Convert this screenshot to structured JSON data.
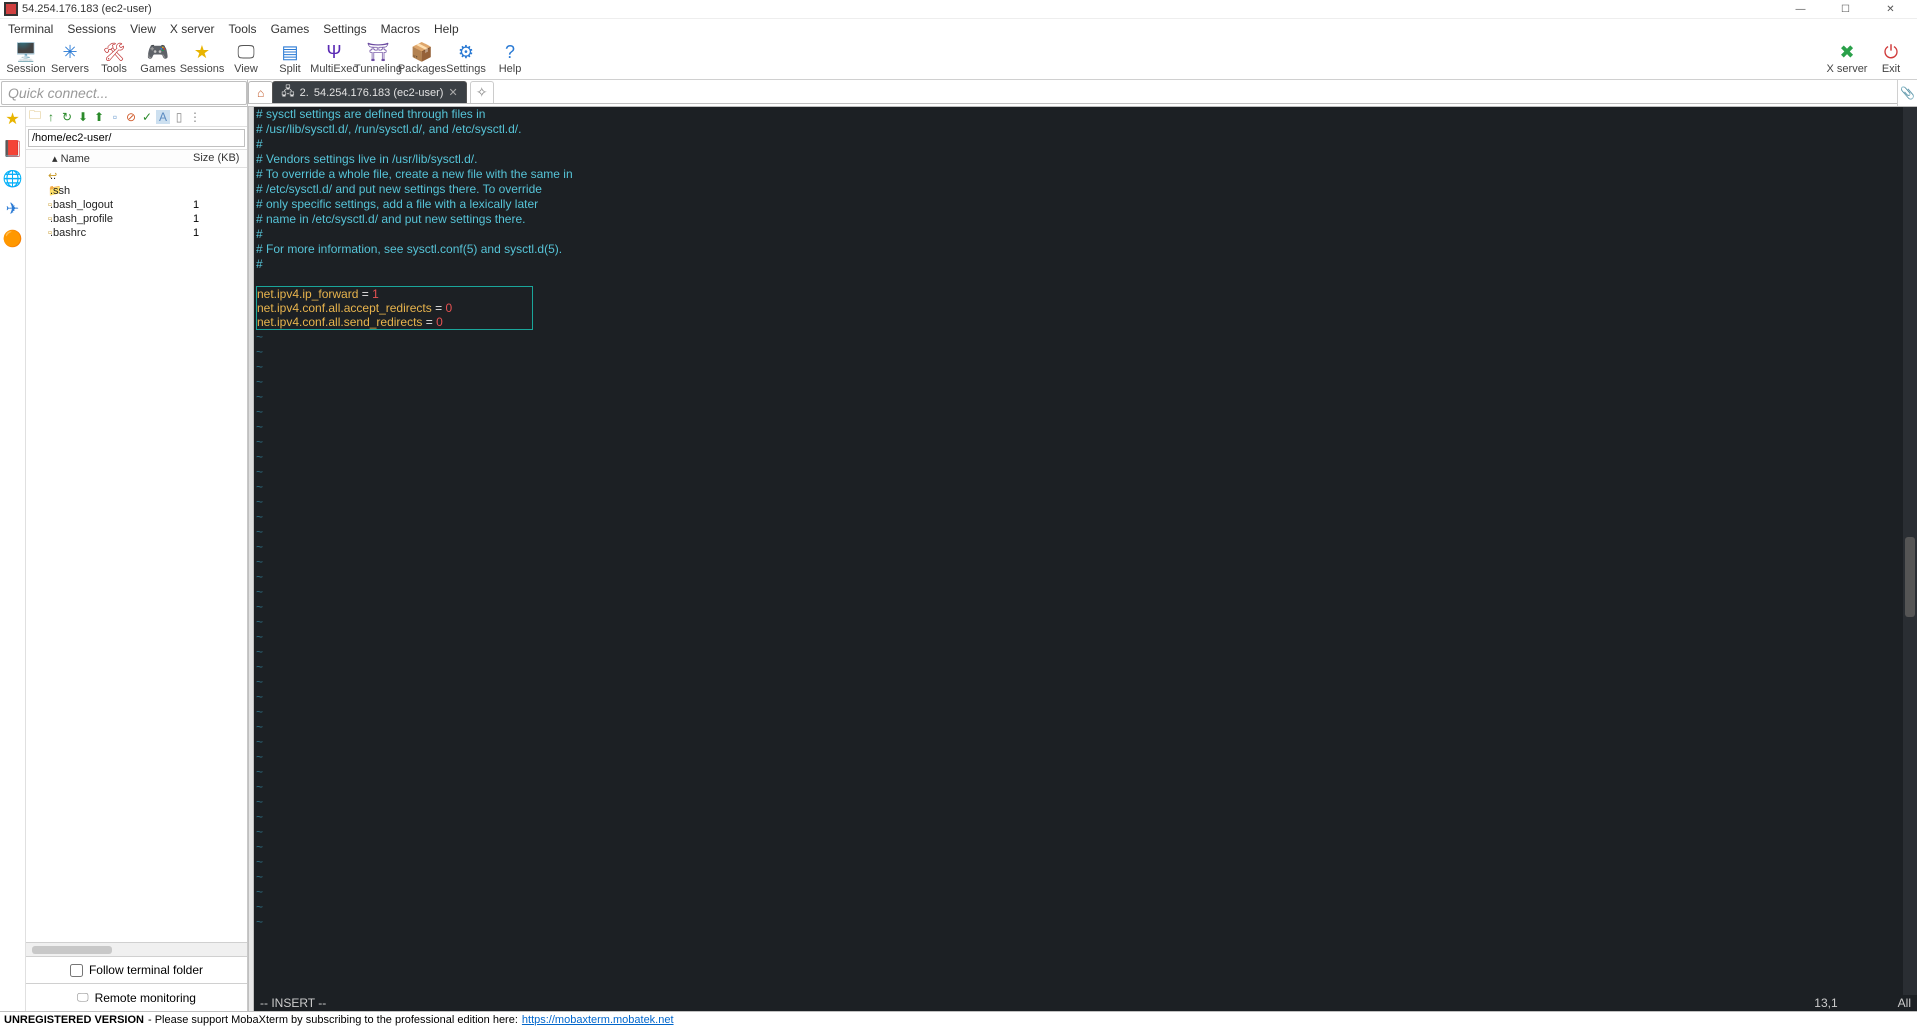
{
  "window": {
    "title": "54.254.176.183 (ec2-user)"
  },
  "menubar": [
    "Terminal",
    "Sessions",
    "View",
    "X server",
    "Tools",
    "Games",
    "Settings",
    "Macros",
    "Help"
  ],
  "toolbar": {
    "items": [
      {
        "label": "Session",
        "icon": "🖥️",
        "color": "#2a7ad4"
      },
      {
        "label": "Servers",
        "icon": "✳",
        "color": "#2a7ad4"
      },
      {
        "label": "Tools",
        "icon": "🛠",
        "color": "#c23a3a"
      },
      {
        "label": "Games",
        "icon": "🎮",
        "color": "#8a6a2a"
      },
      {
        "label": "Sessions",
        "icon": "★",
        "color": "#e8b400"
      },
      {
        "label": "View",
        "icon": "🖵",
        "color": "#555"
      },
      {
        "label": "Split",
        "icon": "▤",
        "color": "#2a7ad4"
      },
      {
        "label": "MultiExec",
        "icon": "Ψ",
        "color": "#5a2ab4"
      },
      {
        "label": "Tunneling",
        "icon": "⛩",
        "color": "#6a4aa0"
      },
      {
        "label": "Packages",
        "icon": "📦",
        "color": "#8a6a2a"
      },
      {
        "label": "Settings",
        "icon": "⚙",
        "color": "#2a7ad4"
      },
      {
        "label": "Help",
        "icon": "?",
        "color": "#2a7ad4"
      }
    ],
    "right": [
      {
        "label": "X server",
        "icon": "✖",
        "color": "#2aa04a"
      },
      {
        "label": "Exit",
        "icon": "⏻",
        "color": "#d03a3a"
      }
    ]
  },
  "quickconnect": {
    "placeholder": "Quick connect..."
  },
  "sidebar": {
    "path": "/home/ec2-user/",
    "columns": {
      "name": "Name",
      "size": "Size (KB)"
    },
    "files": [
      {
        "icon": "↩",
        "name": "..",
        "size": ""
      },
      {
        "icon": "📁",
        "name": ".ssh",
        "size": ""
      },
      {
        "icon": "▫",
        "name": ".bash_logout",
        "size": "1"
      },
      {
        "icon": "▫",
        "name": ".bash_profile",
        "size": "1"
      },
      {
        "icon": "▫",
        "name": ".bashrc",
        "size": "1"
      }
    ],
    "follow": "Follow terminal folder",
    "remote": "Remote monitoring"
  },
  "leftstrip": [
    "★",
    "📕",
    "🌐",
    "✈",
    "🟠"
  ],
  "tabs": {
    "home": {
      "icon": "⌂"
    },
    "active": {
      "num": "2.",
      "label": "54.254.176.183 (ec2-user)",
      "icon": "🖧"
    }
  },
  "terminal": {
    "comments": [
      "# sysctl settings are defined through files in",
      "# /usr/lib/sysctl.d/, /run/sysctl.d/, and /etc/sysctl.d/.",
      "#",
      "# Vendors settings live in /usr/lib/sysctl.d/.",
      "# To override a whole file, create a new file with the same in",
      "# /etc/sysctl.d/ and put new settings there. To override",
      "# only specific settings, add a file with a lexically later",
      "# name in /etc/sysctl.d/ and put new settings there.",
      "#",
      "# For more information, see sysctl.conf(5) and sysctl.d(5).",
      "#"
    ],
    "settings": [
      {
        "key": "net.ipv4.ip_forward",
        "val": "1"
      },
      {
        "key": "net.ipv4.conf.all.accept_redirects",
        "val": "0"
      },
      {
        "key": "net.ipv4.conf.all.send_redirects",
        "val": "0"
      }
    ],
    "status": {
      "mode": "-- INSERT --",
      "pos": "13,1",
      "scroll": "All"
    }
  },
  "footer": {
    "label": "UNREGISTERED VERSION",
    "text": " - Please support MobaXterm by subscribing to the professional edition here: ",
    "link": "https://mobaxterm.mobatek.net"
  }
}
